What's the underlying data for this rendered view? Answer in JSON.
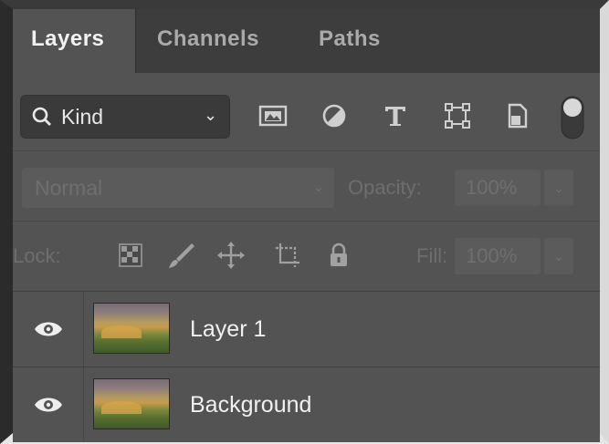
{
  "panel": {
    "tabs": [
      {
        "label": "Layers",
        "active": true
      },
      {
        "label": "Channels",
        "active": false
      },
      {
        "label": "Paths",
        "active": false
      }
    ]
  },
  "filter": {
    "kind_label": "Kind",
    "icons": [
      "image-filter-icon",
      "adjustment-filter-icon",
      "type-filter-icon",
      "shape-filter-icon",
      "smart-object-filter-icon",
      "filter-toggle-icon"
    ]
  },
  "blend": {
    "mode": "Normal",
    "opacity_label": "Opacity:",
    "opacity_value": "100%"
  },
  "lock": {
    "label": "Lock:",
    "icons": [
      "lock-transparent-pixels-icon",
      "lock-image-pixels-icon",
      "lock-position-icon",
      "lock-artboard-icon",
      "lock-all-icon"
    ],
    "fill_label": "Fill:",
    "fill_value": "100%"
  },
  "layers": [
    {
      "name": "Layer 1",
      "visible": true
    },
    {
      "name": "Background",
      "visible": true
    }
  ],
  "colors": {
    "panel_bg": "#535353",
    "tabbar_bg": "#3d3d3d",
    "text_active": "#f2f2f2",
    "text_disabled": "#6f6f6f"
  }
}
